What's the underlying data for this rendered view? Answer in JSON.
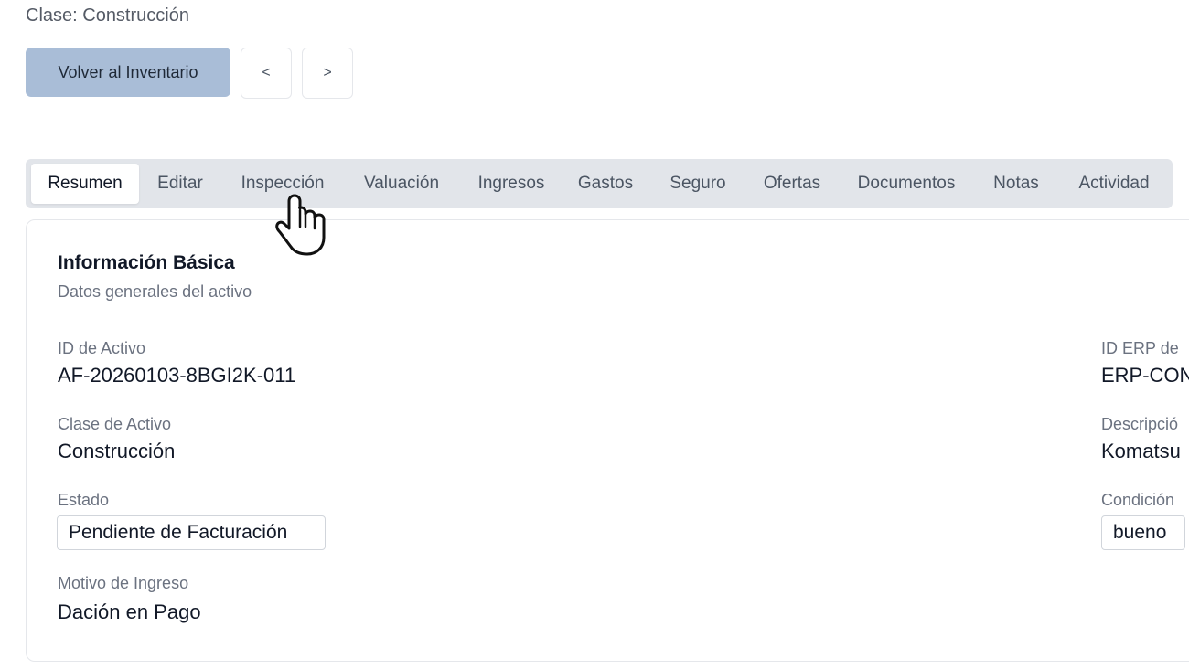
{
  "header": {
    "clase_line": "Clase: Construcción"
  },
  "toolbar": {
    "back_label": "Volver al Inventario",
    "prev_label": "<",
    "next_label": ">"
  },
  "tabs": [
    {
      "label": "Resumen",
      "active": true
    },
    {
      "label": "Editar"
    },
    {
      "label": "Inspección"
    },
    {
      "label": "Valuación"
    },
    {
      "label": "Ingresos"
    },
    {
      "label": "Gastos"
    },
    {
      "label": "Seguro"
    },
    {
      "label": "Ofertas"
    },
    {
      "label": "Documentos"
    },
    {
      "label": "Notas"
    },
    {
      "label": "Actividad"
    }
  ],
  "card": {
    "title": "Información Básica",
    "subtitle": "Datos generales del activo",
    "fields": {
      "asset_id": {
        "label": "ID de Activo",
        "value": "AF-20260103-8BGI2K-011"
      },
      "asset_class": {
        "label": "Clase de Activo",
        "value": "Construcción"
      },
      "status": {
        "label": "Estado",
        "value": "Pendiente de Facturación"
      },
      "reason": {
        "label": "Motivo de Ingreso",
        "value": "Dación en Pago"
      },
      "erp_id": {
        "label": "ID ERP de",
        "value": "ERP-CON"
      },
      "description": {
        "label": "Descripció",
        "value": "Komatsu"
      },
      "condition": {
        "label": "Condición",
        "value": "bueno"
      }
    }
  },
  "colors": {
    "back_button_bg": "#a9bdd7",
    "tabs_bg": "#e2e5ea"
  },
  "cursor_icon": "hand-pointer-icon"
}
